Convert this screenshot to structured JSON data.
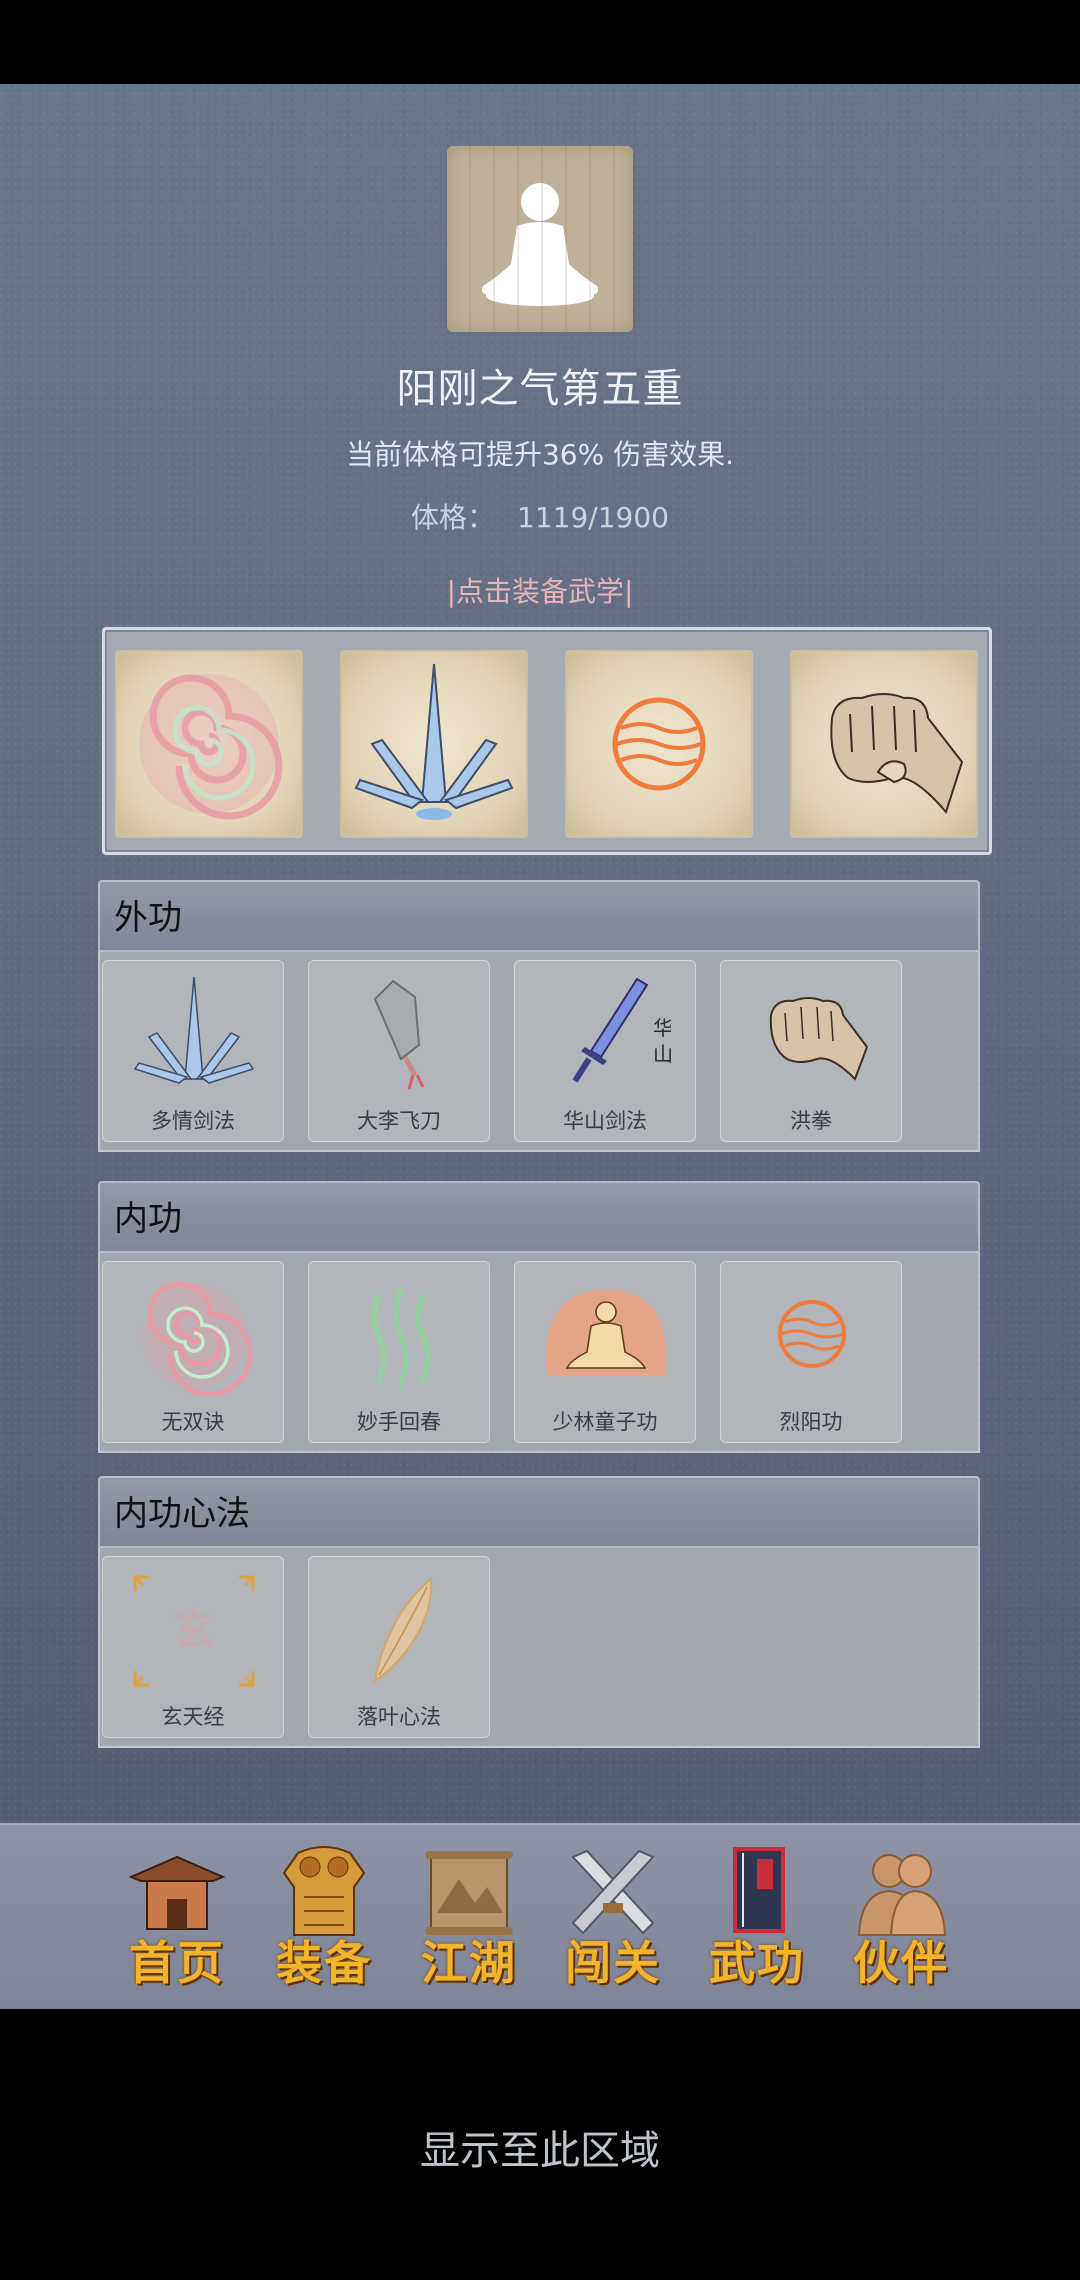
{
  "header": {
    "title": "阳刚之气第五重",
    "description": "当前体格可提升36% 伤害效果.",
    "stat_label": "体格：",
    "stat_value": "1119/1900",
    "equip_hint": "|点击装备武学|"
  },
  "equipped_slots": [
    {
      "icon": "spiral-icon"
    },
    {
      "icon": "crystal-blades-icon"
    },
    {
      "icon": "fire-orb-icon"
    },
    {
      "icon": "fist-icon"
    }
  ],
  "sections": [
    {
      "title": "外功",
      "items": [
        {
          "label": "多情剑法",
          "icon": "crystal-blades-icon"
        },
        {
          "label": "大李飞刀",
          "icon": "cleaver-icon"
        },
        {
          "label": "华山剑法",
          "icon": "sword-icon",
          "icon_text": "华山"
        },
        {
          "label": "洪拳",
          "icon": "fist-icon"
        }
      ]
    },
    {
      "title": "内功",
      "items": [
        {
          "label": "无双诀",
          "icon": "spiral-icon"
        },
        {
          "label": "妙手回春",
          "icon": "green-waves-icon"
        },
        {
          "label": "少林童子功",
          "icon": "meditating-monk-icon"
        },
        {
          "label": "烈阳功",
          "icon": "fire-orb-icon"
        }
      ]
    },
    {
      "title": "内功心法",
      "items": [
        {
          "label": "玄天经",
          "icon": "xuan-seal-icon",
          "icon_text": "玄"
        },
        {
          "label": "落叶心法",
          "icon": "leaf-icon"
        }
      ]
    }
  ],
  "nav": [
    {
      "label": "首页",
      "icon": "pavilion-icon"
    },
    {
      "label": "装备",
      "icon": "armor-icon"
    },
    {
      "label": "江湖",
      "icon": "scroll-map-icon"
    },
    {
      "label": "闯关",
      "icon": "crossed-swords-icon"
    },
    {
      "label": "武功",
      "icon": "martial-manual-icon"
    },
    {
      "label": "伙伴",
      "icon": "companions-icon"
    }
  ],
  "bottom_note": "显示至此区域"
}
